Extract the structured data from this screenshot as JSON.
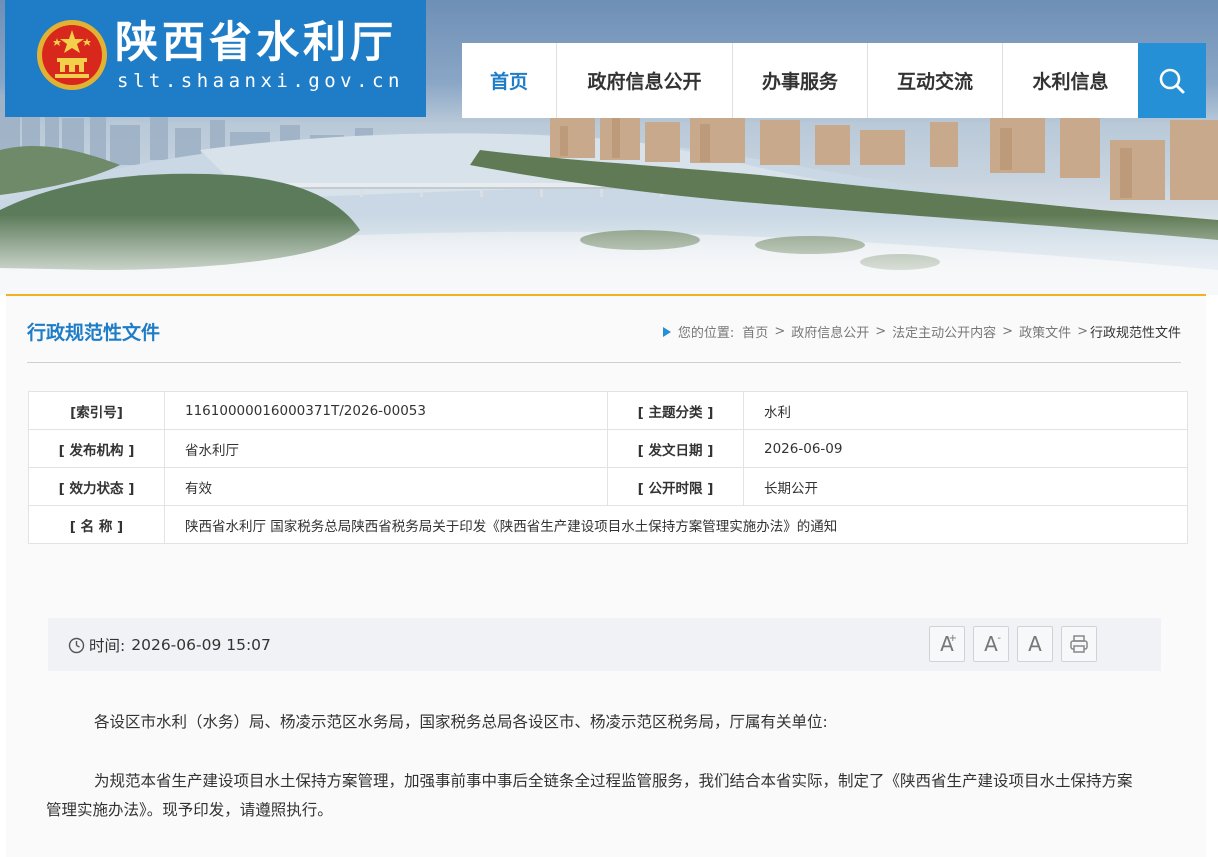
{
  "header": {
    "site_title": "陕西省水利厅",
    "site_url": "slt.shaanxi.gov.cn",
    "nav": [
      {
        "label": "首页",
        "active": true
      },
      {
        "label": "政府信息公开",
        "active": false
      },
      {
        "label": "办事服务",
        "active": false
      },
      {
        "label": "互动交流",
        "active": false
      },
      {
        "label": "水利信息",
        "active": false
      }
    ],
    "search_icon": "search-icon",
    "brand_color": "#1e7dc6"
  },
  "page": {
    "section_title": "行政规范性文件",
    "breadcrumb": {
      "prefix": "您的位置:",
      "items": [
        "首页",
        "政府信息公开",
        "法定主动公开内容",
        "政策文件"
      ],
      "current": "行政规范性文件"
    }
  },
  "meta": {
    "index_no_label": "[索引号]",
    "index_no": "11610000016000371T/2026-00053",
    "topic_label": "[ 主题分类 ]",
    "topic": "水利",
    "issuer_label": "[ 发布机构 ]",
    "issuer": "省水利厅",
    "date_label": "[ 发文日期 ]",
    "date": "2026-06-09",
    "status_label": "[ 效力状态 ]",
    "status": "有效",
    "disclosure_label": "[ 公开时限 ]",
    "disclosure": "长期公开",
    "name_label": "[ 名 称 ]",
    "name": "陕西省水利厅 国家税务总局陕西省税务局关于印发《陕西省生产建设项目水土保持方案管理实施办法》的通知"
  },
  "article": {
    "time_label": "时间:",
    "time_value": "2026-06-09 15:07",
    "tools": {
      "font_large": "A",
      "font_small": "A",
      "font_default": "A",
      "plus": "+",
      "minus": "-"
    },
    "paragraphs": [
      "各设区市水利（水务）局、杨凌示范区水务局，国家税务总局各设区市、杨凌示范区税务局，厅属有关单位:",
      "为规范本省生产建设项目水土保持方案管理，加强事前事中事后全链条全过程监管服务，我们结合本省实际，制定了《陕西省生产建设项目水土保持方案管理实施办法》。现予印发，请遵照执行。"
    ]
  }
}
